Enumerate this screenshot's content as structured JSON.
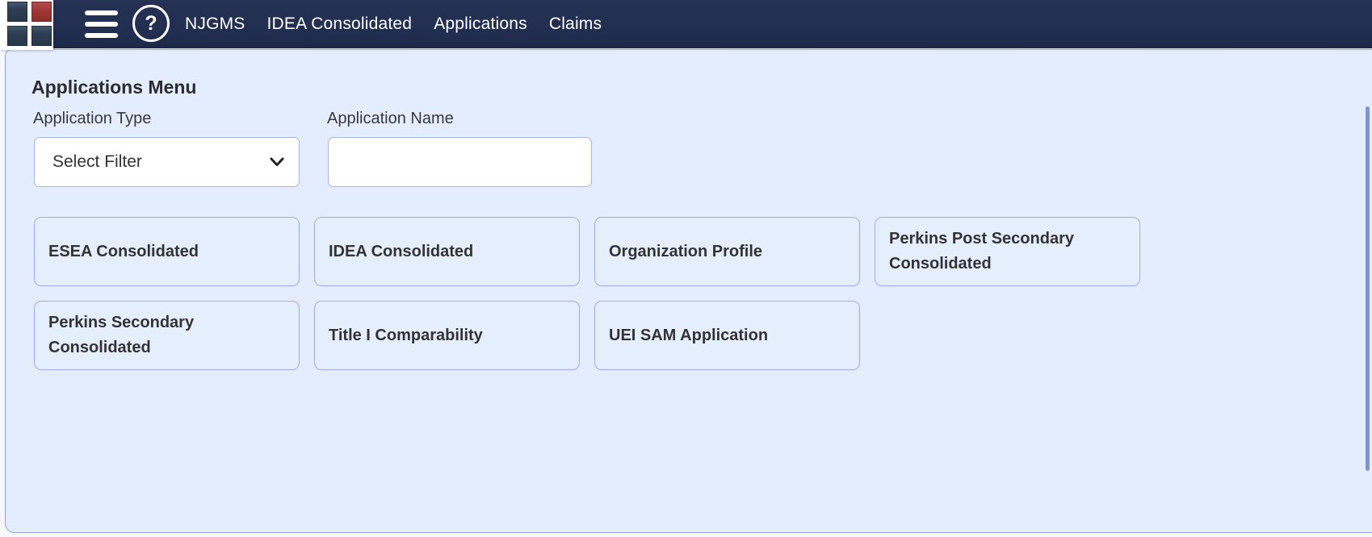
{
  "header": {
    "nav_items": [
      {
        "label": "NJGMS"
      },
      {
        "label": "IDEA Consolidated"
      },
      {
        "label": "Applications"
      },
      {
        "label": "Claims"
      }
    ],
    "help_icon_glyph": "?"
  },
  "main": {
    "title": "Applications Menu",
    "filters": {
      "application_type": {
        "label": "Application Type",
        "selected_option": "Select Filter"
      },
      "application_name": {
        "label": "Application Name",
        "value": ""
      }
    },
    "app_cards": [
      "ESEA Consolidated",
      "IDEA Consolidated",
      "Organization Profile",
      "Perkins Post Secondary Consolidated",
      "Perkins Secondary Consolidated",
      "Title I Comparability",
      "UEI SAM Application"
    ]
  },
  "colors": {
    "header_bg": "#222e50",
    "panel_bg": "#e3edfd",
    "panel_border": "#94a2da",
    "card_border": "#9fabe8",
    "logo_red": "#9c3636",
    "logo_slate": "#2d3e53",
    "scrollbar_thumb": "#8191dc",
    "text_dark": "#333333"
  }
}
